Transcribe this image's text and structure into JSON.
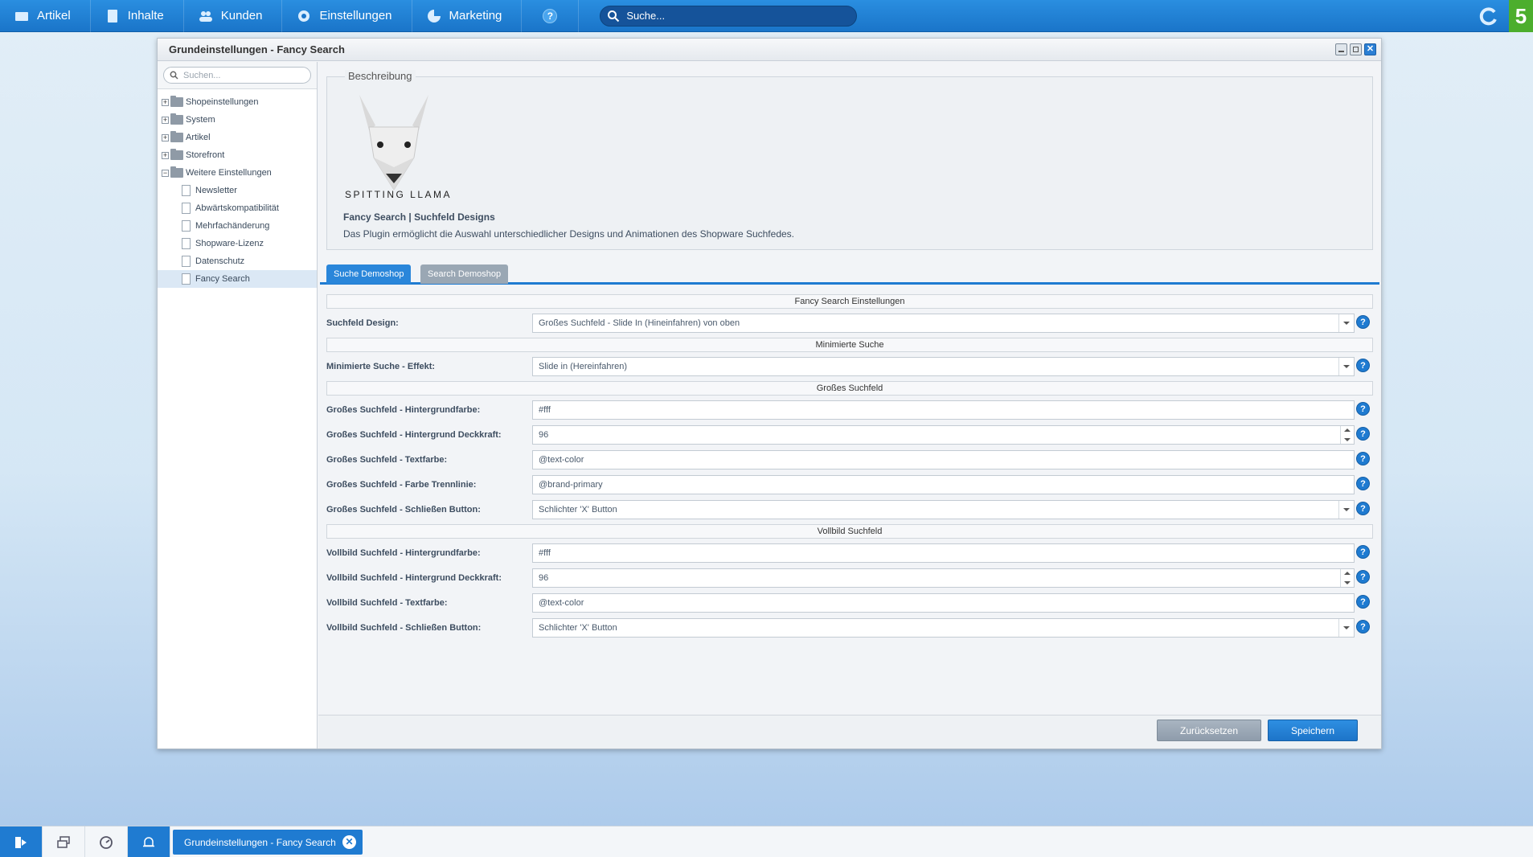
{
  "topbar": {
    "menu": [
      {
        "label": "Artikel",
        "icon": "article-icon"
      },
      {
        "label": "Inhalte",
        "icon": "content-icon"
      },
      {
        "label": "Kunden",
        "icon": "customers-icon"
      },
      {
        "label": "Einstellungen",
        "icon": "gear-icon"
      },
      {
        "label": "Marketing",
        "icon": "marketing-icon"
      }
    ],
    "help_label": "?",
    "search_placeholder": "Suche...",
    "logo_text": "5"
  },
  "window": {
    "title": "Grundeinstellungen - Fancy Search",
    "close_glyph": "✕"
  },
  "tree": {
    "search_placeholder": "Suchen...",
    "folders": [
      {
        "label": "Shopeinstellungen",
        "expanded": false
      },
      {
        "label": "System",
        "expanded": false
      },
      {
        "label": "Artikel",
        "expanded": false
      },
      {
        "label": "Storefront",
        "expanded": false
      },
      {
        "label": "Weitere Einstellungen",
        "expanded": true
      }
    ],
    "expander_plus": "+",
    "expander_minus": "−",
    "children": [
      "Newsletter",
      "Abwärtskompatibilität",
      "Mehrfachänderung",
      "Shopware-Lizenz",
      "Datenschutz",
      "Fancy Search"
    ]
  },
  "description": {
    "legend": "Beschreibung",
    "brand": "SPITTING LLAMA",
    "title": "Fancy Search | Suchfeld Designs",
    "text": "Das Plugin ermöglicht die Auswahl unterschiedlicher Designs und Animationen des Shopware Suchfedes."
  },
  "tabs": {
    "active": "Suche Demoshop",
    "inactive": "Search Demoshop"
  },
  "form": {
    "section_main": "Fancy Search Einstellungen",
    "design_label": "Suchfeld Design:",
    "design_value": "Großes Suchfeld - Slide In (Hineinfahren) von oben",
    "section_min": "Minimierte Suche",
    "min_effect_label": "Minimierte Suche - Effekt:",
    "min_effect_value": "Slide in (Hereinfahren)",
    "section_large": "Großes Suchfeld",
    "large_bg_label": "Großes Suchfeld - Hintergrundfarbe:",
    "large_bg_value": "#fff",
    "large_opacity_label": "Großes Suchfeld - Hintergrund Deckkraft:",
    "large_opacity_value": "96",
    "large_text_label": "Großes Suchfeld - Textfarbe:",
    "large_text_value": "@text-color",
    "large_divider_label": "Großes Suchfeld - Farbe Trennlinie:",
    "large_divider_value": "@brand-primary",
    "large_close_label": "Großes Suchfeld - Schließen Button:",
    "large_close_value": "Schlichter 'X' Button",
    "section_full": "Vollbild Suchfeld",
    "full_bg_label": "Vollbild Suchfeld - Hintergrundfarbe:",
    "full_bg_value": "#fff",
    "full_opacity_label": "Vollbild Suchfeld - Hintergrund Deckkraft:",
    "full_opacity_value": "96",
    "full_text_label": "Vollbild Suchfeld - Textfarbe:",
    "full_text_value": "@text-color",
    "full_close_label": "Vollbild Suchfeld - Schließen Button:",
    "full_close_value": "Schlichter 'X' Button",
    "help_glyph": "?"
  },
  "footer": {
    "reset_label": "Zurücksetzen",
    "save_label": "Speichern"
  },
  "taskbar": {
    "window_label": "Grundeinstellungen - Fancy Search",
    "close_glyph": "✕"
  },
  "colors": {
    "accent": "#1f7bd1",
    "topbar": "#1a75c9",
    "logo": "#4cae2d"
  }
}
